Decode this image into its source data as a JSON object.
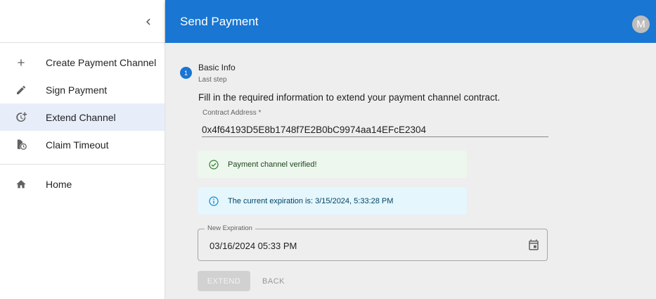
{
  "app": {
    "title": "Send Payment",
    "avatar_initial": "M"
  },
  "sidebar": {
    "collapse_icon": "chevron-left-icon",
    "items": [
      {
        "label": "Create Payment Channel",
        "icon": "plus-icon",
        "active": false
      },
      {
        "label": "Sign Payment",
        "icon": "pencil-icon",
        "active": false
      },
      {
        "label": "Extend Channel",
        "icon": "clock-plus-icon",
        "active": true
      },
      {
        "label": "Claim Timeout",
        "icon": "timer-icon",
        "active": false
      },
      {
        "label": "Home",
        "icon": "home-icon",
        "active": false
      }
    ]
  },
  "stepper": {
    "step_number": "1",
    "title": "Basic Info",
    "subtitle": "Last step"
  },
  "form": {
    "instructions": "Fill in the required information to extend your payment channel contract.",
    "contract_label": "Contract Address *",
    "contract_value": "0x4f64193D5E8b1748f7E2B0bC9974aa14EFcE2304",
    "success_message": "Payment channel verified!",
    "info_message": "The current expiration is: 3/15/2024, 5:33:28 PM",
    "new_expiration_label": "New Expiration",
    "new_expiration_value": "03/16/2024 05:33 PM",
    "extend_label": "EXTEND",
    "back_label": "BACK"
  },
  "colors": {
    "primary": "#1976d2",
    "success_bg": "#edf7ed",
    "info_bg": "#e5f6fd",
    "active_nav": "#e8eef9"
  }
}
